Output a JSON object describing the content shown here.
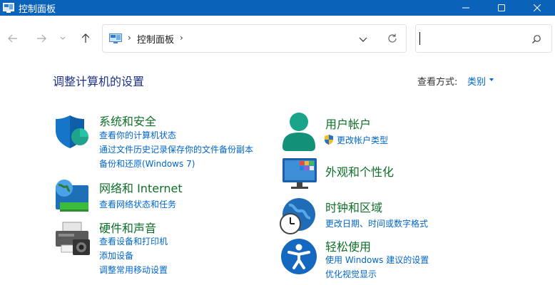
{
  "window": {
    "title": "控制面板"
  },
  "address": {
    "crumb": "控制面板",
    "search_placeholder": ""
  },
  "content": {
    "heading": "调整计算机的设置",
    "view_by_label": "查看方式:",
    "view_by_value": "类别"
  },
  "categories": {
    "system": {
      "title": "系统和安全",
      "links": [
        "查看你的计算机状态",
        "通过文件历史记录保存你的文件备份副本",
        "备份和还原(Windows 7)"
      ]
    },
    "network": {
      "title": "网络和 Internet",
      "links": [
        "查看网络状态和任务"
      ]
    },
    "hardware": {
      "title": "硬件和声音",
      "links": [
        "查看设备和打印机",
        "添加设备",
        "调整常用移动设置"
      ]
    },
    "user": {
      "title": "用户帐户",
      "links": [
        "更改帐户类型"
      ]
    },
    "appearance": {
      "title": "外观和个性化",
      "links": []
    },
    "clock": {
      "title": "时钟和区域",
      "links": [
        "更改日期、时间或数字格式"
      ]
    },
    "ease": {
      "title": "轻松使用",
      "links": [
        "使用 Windows 建议的设置",
        "优化视觉显示"
      ]
    }
  },
  "colors": {
    "titlebar": "#0a63b8",
    "category_title": "#0e6f28",
    "link": "#0066cc",
    "heading": "#1e3287"
  },
  "icons": [
    "control-panel-icon",
    "minimize-icon",
    "maximize-icon",
    "close-icon",
    "back-arrow-icon",
    "forward-arrow-icon",
    "recent-chevron-icon",
    "up-arrow-icon",
    "chevron-down-icon",
    "refresh-icon",
    "search-icon",
    "shield-icon",
    "globe-network-icon",
    "printer-icon",
    "user-icon",
    "uac-shield-icon",
    "monitor-icon",
    "clock-globe-icon",
    "accessibility-icon"
  ]
}
